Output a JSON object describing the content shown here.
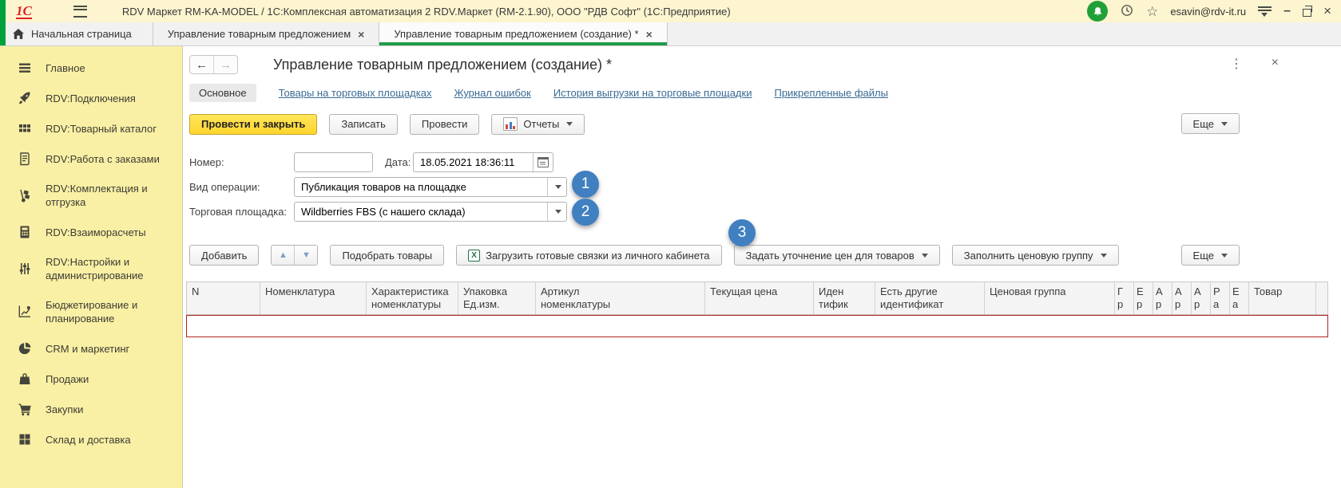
{
  "titlebar": {
    "logo": "1С",
    "title": "RDV Маркет RM-KA-MODEL / 1С:Комплексная автоматизация 2 RDV.Маркет (RM-2.1.90), ООО \"РДВ Софт\"  (1С:Предприятие)",
    "user_email": "esavin@rdv-it.ru"
  },
  "window_tabs": {
    "home": "Начальная страница",
    "items": [
      {
        "label": "Управление товарным предложением"
      },
      {
        "label": "Управление товарным предложением (создание) *"
      }
    ]
  },
  "sidebar": {
    "items": [
      {
        "label": "Главное"
      },
      {
        "label": "RDV:Подключения"
      },
      {
        "label": "RDV:Товарный каталог"
      },
      {
        "label": "RDV:Работа с заказами"
      },
      {
        "label": "RDV:Комплектация и отгрузка"
      },
      {
        "label": "RDV:Взаиморасчеты"
      },
      {
        "label": "RDV:Настройки и администрирование"
      },
      {
        "label": "Бюджетирование и планирование"
      },
      {
        "label": "CRM и маркетинг"
      },
      {
        "label": "Продажи"
      },
      {
        "label": "Закупки"
      },
      {
        "label": "Склад и доставка"
      }
    ]
  },
  "form": {
    "title": "Управление товарным предложением (создание) *",
    "nav": {
      "active_tab": "Основное",
      "links": [
        "Товары на торговых площадках",
        "Журнал ошибок",
        "История выгрузки на торговые площадки",
        "Прикрепленные файлы"
      ]
    },
    "commands": {
      "post_close": "Провести и закрыть",
      "write": "Записать",
      "post": "Провести",
      "reports": "Отчеты",
      "more": "Еще"
    },
    "fields": {
      "number_label": "Номер:",
      "number_value": "",
      "date_label": "Дата:",
      "date_value": "18.05.2021 18:36:11",
      "operation_label": "Вид операции:",
      "operation_value": "Публикация товаров на площадке",
      "marketplace_label": "Торговая площадка:",
      "marketplace_value": "Wildberries FBS (с нашего склада)"
    },
    "table_toolbar": {
      "add": "Добавить",
      "pick": "Подобрать товары",
      "load_bundles": "Загрузить готовые связки из личного кабинета",
      "set_prices": "Задать уточнение цен для товаров",
      "fill_price_group": "Заполнить ценовую группу",
      "more": "Еще"
    },
    "grid": {
      "columns": [
        {
          "l1": "N",
          "l2": ""
        },
        {
          "l1": "Номенклатура",
          "l2": ""
        },
        {
          "l1": "Характеристика",
          "l2": "номенклатуры"
        },
        {
          "l1": "Упаковка",
          "l2": "Ед.изм."
        },
        {
          "l1": "Артикул",
          "l2": "номенклатуры"
        },
        {
          "l1": "Текущая цена",
          "l2": ""
        },
        {
          "l1": "Иден",
          "l2": "тифик"
        },
        {
          "l1": "Есть другие",
          "l2": "идентификат"
        },
        {
          "l1": "Ценовая группа",
          "l2": ""
        },
        {
          "l1": "Г",
          "l2": "р"
        },
        {
          "l1": "Е",
          "l2": "р"
        },
        {
          "l1": "А",
          "l2": "р"
        },
        {
          "l1": "А",
          "l2": "р"
        },
        {
          "l1": "А",
          "l2": "р"
        },
        {
          "l1": "Р",
          "l2": "а"
        },
        {
          "l1": "Е",
          "l2": "а"
        },
        {
          "l1": "Товар",
          "l2": ""
        },
        {
          "l1": "",
          "l2": ""
        }
      ]
    },
    "badges": {
      "one": "1",
      "two": "2",
      "three": "3"
    }
  },
  "icons": {
    "close": "×",
    "more_vertical": "⋮",
    "star": "☆",
    "minimize": "–",
    "back": "←",
    "forward": "→",
    "up": "▲",
    "down": "▼",
    "excel_x": "X"
  },
  "colors": {
    "accent_green": "#00A13A",
    "brand_red": "#E31E24",
    "titlebar_yellow": "#FCF5CF",
    "sidebar_yellow": "#FAF0A5",
    "primary_button_yellow": "#FFDD3C",
    "badge_blue": "#4080C0",
    "link_blue": "#3A6B94",
    "grid_error_red": "#B22222",
    "excel_green": "#217346",
    "notification_green": "#21A038",
    "toolbar_arrow_blue": "#7F9FC6"
  }
}
